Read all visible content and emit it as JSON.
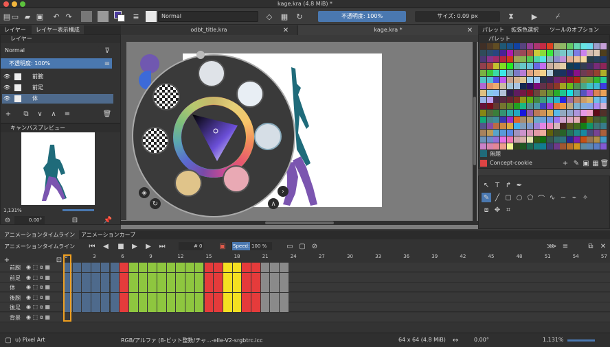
{
  "window": {
    "title": "kage.kra (4.8 MiB)  *"
  },
  "toolbar": {
    "blend_mode": "Normal",
    "opacity_label": "不透明度: 100%",
    "size_label": "サイズ: 0.09 px"
  },
  "left_tabs": {
    "layer": "レイヤー",
    "layer_display": "レイヤー表示構成"
  },
  "layers_panel": {
    "header": "レイヤー",
    "blend_mode": "Normal",
    "opacity": "不透明度: 100%",
    "rows": [
      {
        "name": "前腕"
      },
      {
        "name": "前足"
      },
      {
        "name": "体"
      }
    ]
  },
  "preview_panel": {
    "header": "キャンバスプレビュー",
    "zoom": "1,131%",
    "rotation": "0.00°"
  },
  "doc_tabs": [
    {
      "name": "odbt_title.kra"
    },
    {
      "name": "kage.kra *"
    }
  ],
  "right_tabs": {
    "palette": "パレット",
    "extended": "拡張色選択",
    "tool_options": "ツールのオプション"
  },
  "palette_panel": {
    "header": "パレット",
    "swatch_name": "無題",
    "palette_name": "Concept-cookie"
  },
  "anim_tabs": {
    "timeline": "アニメーションタイムライン",
    "curves": "アニメーションカーブ"
  },
  "timeline": {
    "title": "アニメーションタイムライン",
    "frame_label": "#",
    "frame_value": "0",
    "speed_label": "Speed:",
    "speed_value": "100 %",
    "frame_numbers": [
      "0",
      "3",
      "6",
      "9",
      "12",
      "15",
      "18",
      "21",
      "24",
      "27",
      "30",
      "33",
      "36",
      "39",
      "42",
      "45",
      "48",
      "51",
      "54",
      "57"
    ],
    "layers": [
      {
        "name": "前腕"
      },
      {
        "name": "前足"
      },
      {
        "name": "体"
      },
      {
        "name": "後腕"
      },
      {
        "name": "後足"
      },
      {
        "name": "背景"
      }
    ]
  },
  "status": {
    "brush": "u) Pixel Art",
    "color_space": "RGB/アルファ (8-ビット整数/チャ...-elle-V2-srgbtrc.icc",
    "image_size": "64 x 64 (4.8 MiB)",
    "rotation": "0.00°",
    "zoom": "1,131%"
  },
  "colors": {
    "accent": "#4a78b0",
    "blue": "#4e6a8c",
    "red": "#e53b3b",
    "green": "#8ec63f",
    "yellow": "#f4e021",
    "gray": "#8a8a8a",
    "teal": "#1f6b7a",
    "purple": "#7b55b0"
  }
}
